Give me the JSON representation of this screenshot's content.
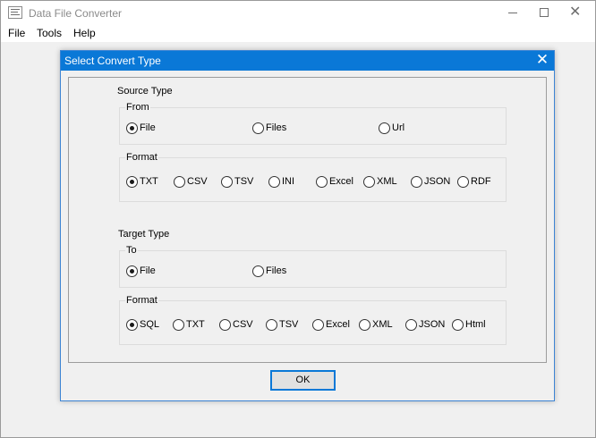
{
  "window": {
    "title": "Data File Converter",
    "controls": {
      "minimize_icon": "minimize-icon",
      "maximize_icon": "maximize-icon",
      "close_icon": "close-icon",
      "close_glyph": "✕"
    }
  },
  "menubar": {
    "items": [
      "File",
      "Tools",
      "Help"
    ]
  },
  "dialog": {
    "title": "Select Convert Type",
    "close_glyph": "✕",
    "source": {
      "heading": "Source Type",
      "from": {
        "legend": "From",
        "options": [
          "File",
          "Files",
          "Url"
        ],
        "selected": "File"
      },
      "format": {
        "legend": "Format",
        "options": [
          "TXT",
          "CSV",
          "TSV",
          "INI",
          "Excel",
          "XML",
          "JSON",
          "RDF"
        ],
        "selected": "TXT"
      }
    },
    "target": {
      "heading": "Target Type",
      "to": {
        "legend": "To",
        "options": [
          "File",
          "Files"
        ],
        "selected": "File"
      },
      "format": {
        "legend": "Format",
        "options": [
          "SQL",
          "TXT",
          "CSV",
          "TSV",
          "Excel",
          "XML",
          "JSON",
          "Html"
        ],
        "selected": "SQL"
      }
    },
    "ok_label": "OK"
  },
  "colors": {
    "accent": "#0a78d7",
    "dialog_border": "#3c84d4",
    "background": "#f0f0f0"
  }
}
